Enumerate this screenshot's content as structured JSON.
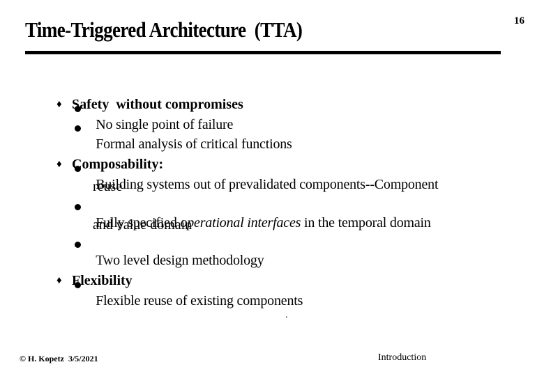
{
  "slide": {
    "title": "Time-Triggered Architecture  (TTA)",
    "page_number": "16",
    "bullets": [
      {
        "label": "Safety  without compromises",
        "subitems": [
          {
            "text": "No single point of failure"
          },
          {
            "text": "Formal analysis of critical functions"
          }
        ]
      },
      {
        "label": "Composability:",
        "subitems": [
          {
            "text": "Building systems out of prevalidated components--Component",
            "cont": "reuse"
          },
          {
            "pre": "Fully specified ",
            "em": "operational interfaces",
            "post": " in the temporal domain",
            "cont": "and value domain"
          },
          {
            "text": "Two level design methodology"
          }
        ]
      },
      {
        "label": "Flexibility",
        "subitems": [
          {
            "text": "Flexible reuse of existing components"
          }
        ]
      }
    ],
    "stray_mark": ".",
    "footer": {
      "left": "© H. Kopetz  3/5/2021",
      "right": "Introduction"
    },
    "icons": {
      "level1": "diamond-bullet",
      "level2": "round-bullet"
    }
  }
}
